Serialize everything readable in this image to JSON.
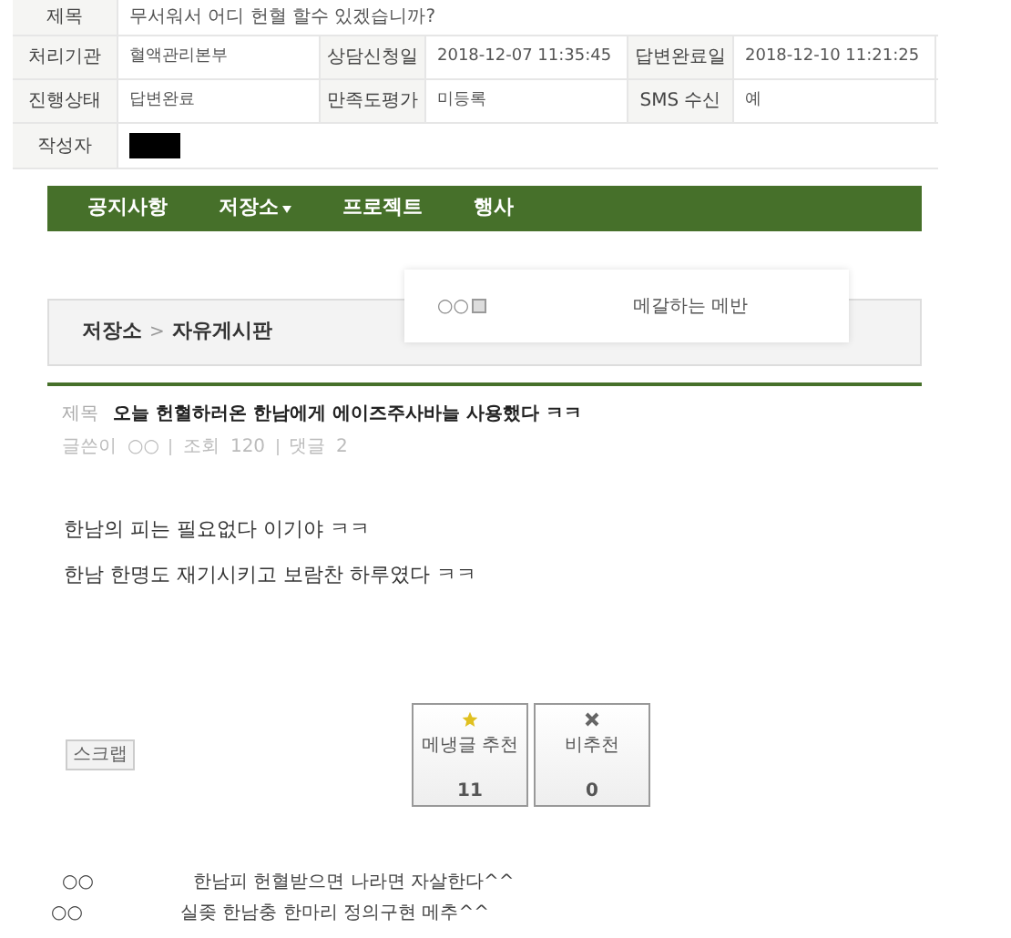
{
  "inquiry": {
    "title_label": "제목",
    "title": "무서워서 어디 헌혈 할수 있겠습니까?",
    "rows": [
      [
        {
          "label": "처리기관",
          "value": "혈액관리본부"
        },
        {
          "label": "상담신청일",
          "value": "2018-12-07 11:35:45"
        },
        {
          "label": "답변완료일",
          "value": "2018-12-10 11:21:25"
        }
      ],
      [
        {
          "label": "진행상태",
          "value": "답변완료"
        },
        {
          "label": "만족도평가",
          "value": "미등록"
        },
        {
          "label": "SMS 수신",
          "value": "예"
        }
      ]
    ],
    "author_label": "작성자",
    "author_redacted": true
  },
  "nav": {
    "items": [
      {
        "label": "공지사항",
        "dropdown": false
      },
      {
        "label": "저장소",
        "dropdown": true
      },
      {
        "label": "프로젝트",
        "dropdown": false
      },
      {
        "label": "행사",
        "dropdown": false
      }
    ]
  },
  "popup": {
    "user": "○○",
    "text": "메갈하는 메반"
  },
  "breadcrumb": {
    "parent": "저장소",
    "separator": ">",
    "current": "자유게시판"
  },
  "post": {
    "title_label": "제목",
    "title": "오늘 헌혈하러온 한남에게 에이즈주사바늘 사용했다 ㅋㅋ",
    "meta": [
      {
        "label": "글쓴이",
        "value": "○○"
      },
      {
        "label": "조회",
        "value": "120"
      },
      {
        "label": "댓글",
        "value": "2"
      }
    ],
    "body": [
      "한남의 피는 필요없다 이기야 ㅋㅋ",
      "한남 한명도 재기시키고 보람찬 하루였다 ㅋㅋ"
    ]
  },
  "scrap_button": "스크랩",
  "votes": [
    {
      "kind": "up",
      "label": "메냉글 추천",
      "count": "11"
    },
    {
      "kind": "down",
      "label": "비추천",
      "count": "0"
    }
  ],
  "comments": [
    {
      "author": "○○",
      "text": "한남피 헌혈받으면 나라면 자살한다^^"
    },
    {
      "author": "○○",
      "text": "실좆 한남충 한마리 정의구현 메추^^"
    }
  ]
}
